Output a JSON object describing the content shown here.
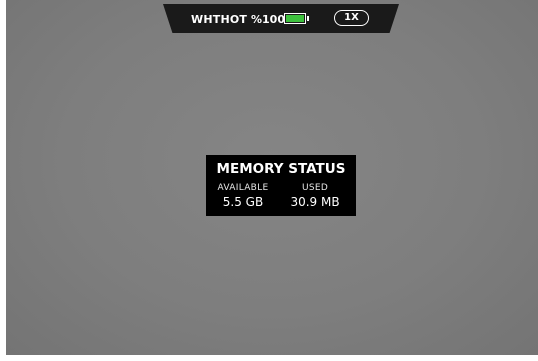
{
  "status_bar": {
    "mode": "WHTHOT",
    "battery_percent": "%100",
    "battery_level": 1.0,
    "battery_color": "#3ec13e",
    "zoom": "1X"
  },
  "memory_status": {
    "title": "MEMORY STATUS",
    "available_label": "AVAILABLE",
    "available_value": "5.5 GB",
    "used_label": "USED",
    "used_value": "30.9 MB"
  }
}
